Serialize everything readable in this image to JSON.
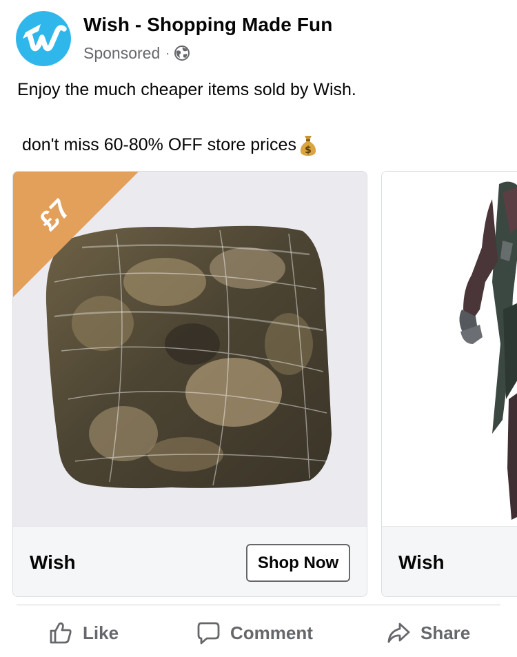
{
  "post": {
    "page_name": "Wish - Shopping Made Fun",
    "sponsored_label": "Sponsored",
    "separator": "·",
    "text_line_1": "Enjoy the much cheaper items sold by Wish.",
    "text_line_2": "don't miss 60-80% OFF store prices"
  },
  "icons": {
    "avatar": "wish-logo-icon",
    "privacy": "globe-icon",
    "emoji": "money-bag-icon",
    "like": "thumbs-up-icon",
    "comment": "speech-bubble-icon",
    "share": "share-arrow-icon"
  },
  "carousel": {
    "cards": [
      {
        "price_badge": "£7",
        "image": "wrapped-brown-block-product-photo",
        "title": "Wish",
        "cta_label": "Shop Now"
      },
      {
        "image": "armored-figure-product-photo",
        "title": "Wish"
      }
    ]
  },
  "actions": {
    "like_label": "Like",
    "comment_label": "Comment",
    "share_label": "Share"
  },
  "colors": {
    "brand_blue": "#2fb7ec",
    "badge_orange": "#e2a05a",
    "secondary_text": "#65676b"
  }
}
